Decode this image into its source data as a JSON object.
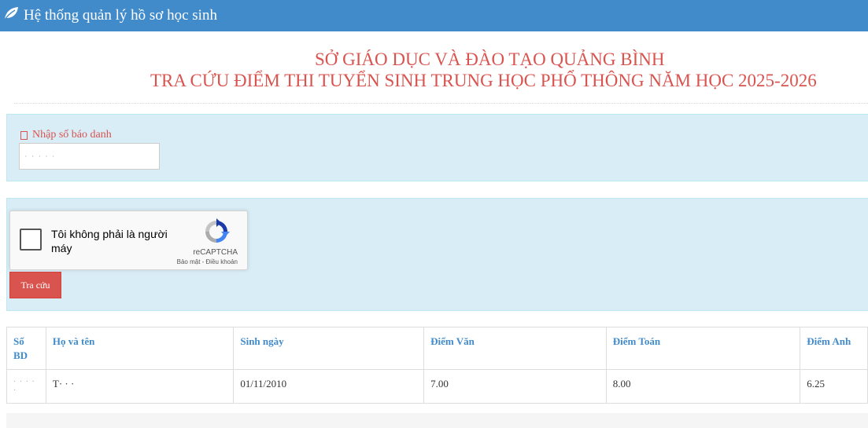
{
  "navbar": {
    "brand_icon": "leaf-icon",
    "title": "Hệ thống quản lý hồ sơ học sinh",
    "bg_color": "#428bca"
  },
  "heading": {
    "line1": "SỞ GIÁO DỤC VÀ ĐÀO TẠO QUẢNG BÌNH",
    "line2": "TRA CỨU ĐIỂM THI TUYỂN SINH TRUNG HỌC PHỔ THÔNG NĂM HỌC 2025-2026",
    "color": "#d9534f"
  },
  "search_form": {
    "label": "Nhập số báo danh",
    "input_value": "· · · · ·"
  },
  "captcha": {
    "label": "Tôi không phải là người máy",
    "brand": "reCAPTCHA",
    "links": "Bảo mật - Điều khoản",
    "checked": false
  },
  "submit": {
    "label": "Tra cứu",
    "color": "#d9534f"
  },
  "results": {
    "columns": [
      "Số BD",
      "Họ và tên",
      "Sinh ngày",
      "Điểm Văn",
      "Điểm Toán",
      "Điểm Anh"
    ],
    "rows": [
      {
        "sbd": "· · · · ·",
        "name": "T· · ·",
        "dob": "01/11/2010",
        "van": "7.00",
        "toan": "8.00",
        "anh": "6.25"
      }
    ]
  }
}
